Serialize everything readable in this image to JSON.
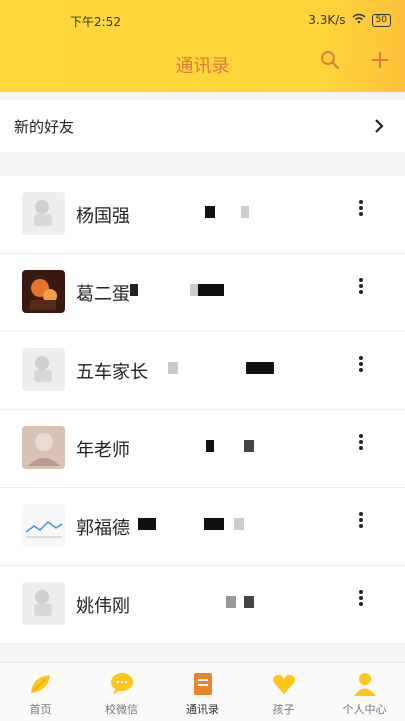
{
  "status_bar": {
    "time": "下午2:52",
    "speed": "3.3K/s",
    "battery": "50"
  },
  "header": {
    "title": "通讯录"
  },
  "new_friends": {
    "label": "新的好友"
  },
  "contacts": [
    {
      "name": "杨国强"
    },
    {
      "name": "葛二蛋"
    },
    {
      "name": "五车家长"
    },
    {
      "name": "年老师"
    },
    {
      "name": "郭福德"
    },
    {
      "name": "姚伟刚"
    }
  ],
  "tabs": [
    {
      "label": "首页",
      "icon": "leaf-icon"
    },
    {
      "label": "校微信",
      "icon": "chat-bubble-icon"
    },
    {
      "label": "通讯录",
      "icon": "contacts-book-icon"
    },
    {
      "label": "孩子",
      "icon": "heart-icon"
    },
    {
      "label": "个人中心",
      "icon": "person-icon"
    }
  ],
  "colors": {
    "header_bg": "#ffd83a",
    "title": "#e07a3a",
    "tab_icon": "#ffc61a",
    "active_tab_icon": "#e8842a"
  }
}
